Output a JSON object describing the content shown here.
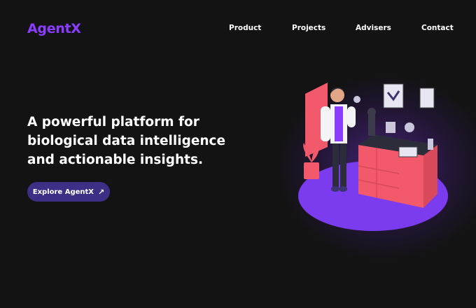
{
  "brand": {
    "name": "AgentX"
  },
  "nav": {
    "items": [
      "Product",
      "Projects",
      "Advisers",
      "Contact"
    ]
  },
  "hero": {
    "headline": "A powerful platform for biological data intelligence and actionable insights.",
    "cta_label": "Explore AgentX",
    "cta_icon": "arrow-up-right-icon"
  },
  "colors": {
    "background": "#131314",
    "accent": "#8a3dff",
    "button": "#3d2f86",
    "platform": "#7b3cf0",
    "cabinet": "#f2596a"
  }
}
